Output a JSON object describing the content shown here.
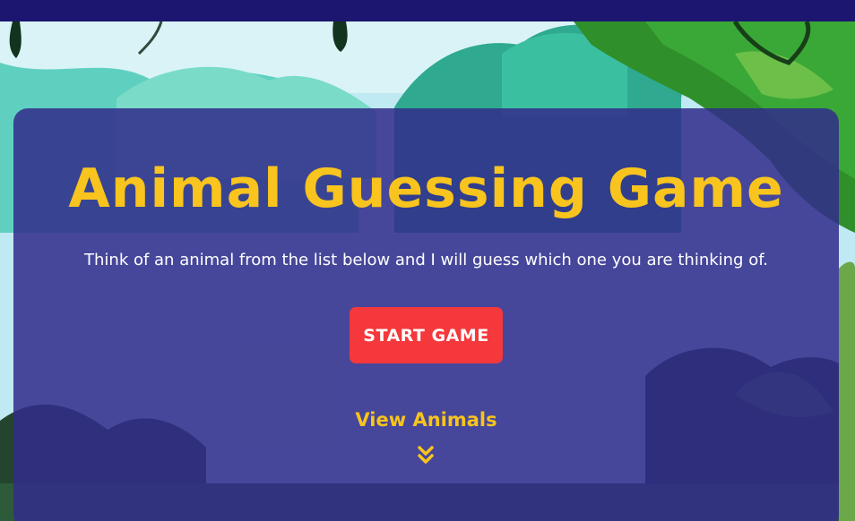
{
  "header": {
    "bar_color": "#1c1670"
  },
  "hero": {
    "title": "Animal Guessing Game",
    "subtitle": "Think of an animal from the list below and I will guess which one you are thinking of.",
    "start_button_label": "START GAME",
    "view_animals_label": "View Animals",
    "scroll_icon": "double-chevron-down-icon"
  },
  "colors": {
    "title": "#f8c41d",
    "panel": "#322c8a",
    "start_button": "#f4383b",
    "link": "#f8c41d",
    "sky": "#bfe9f3"
  },
  "background": {
    "theme": "jungle-illustration"
  }
}
